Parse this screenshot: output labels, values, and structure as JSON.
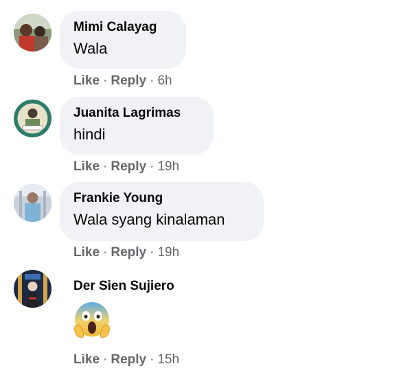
{
  "comments": [
    {
      "author": "Mimi Calayag",
      "text": "Wala",
      "like_label": "Like",
      "reply_label": "Reply",
      "time": "6h"
    },
    {
      "author": "Juanita Lagrimas",
      "text": "hindi",
      "like_label": "Like",
      "reply_label": "Reply",
      "time": "19h"
    },
    {
      "author": "Frankie Young",
      "text": "Wala syang kinalaman",
      "like_label": "Like",
      "reply_label": "Reply",
      "time": "19h"
    },
    {
      "author": "Der Sien Sujiero",
      "emoji": "face-screaming-in-fear",
      "like_label": "Like",
      "reply_label": "Reply",
      "time": "15h"
    }
  ],
  "separator": "·",
  "colors": {
    "bubble": "#f0f2f5",
    "meta_text": "#65676b",
    "body_text": "#050505"
  }
}
